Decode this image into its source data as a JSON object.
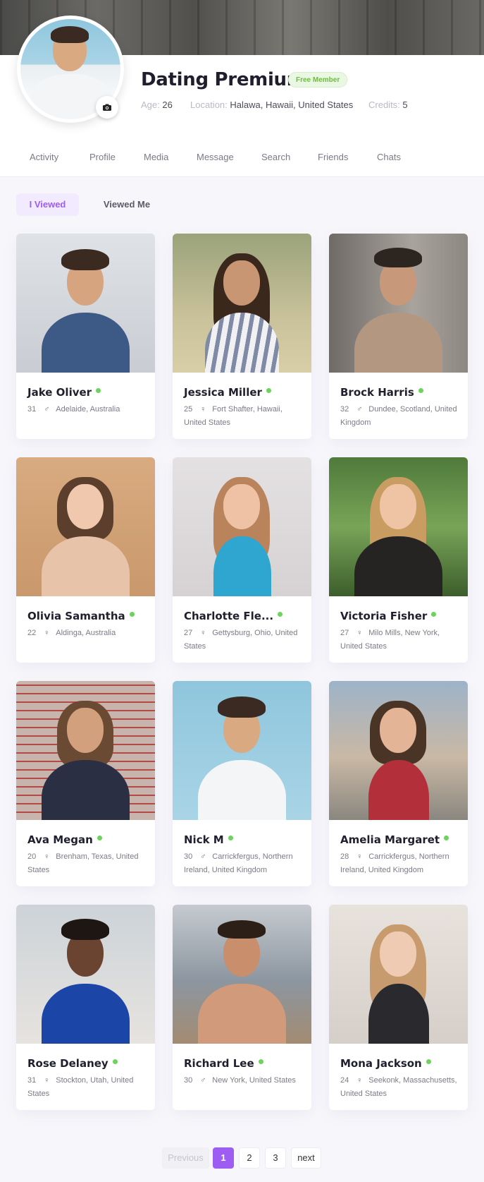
{
  "profile": {
    "name": "Dating Premium",
    "badge": "Free Member",
    "age_label": "Age:",
    "age": "26",
    "location_label": "Location:",
    "location": "Halawa, Hawaii, United States",
    "credits_label": "Credits:",
    "credits": "5"
  },
  "tabs": [
    "Activity",
    "Profile",
    "Media",
    "Message",
    "Search",
    "Friends",
    "Chats"
  ],
  "subtabs": {
    "active": "I Viewed",
    "other": "Viewed Me"
  },
  "members": [
    {
      "name": "Jake Oliver",
      "age": "31",
      "gender": "♂",
      "location": "Adelaide, Australia"
    },
    {
      "name": "Jessica Miller",
      "age": "25",
      "gender": "♀",
      "location": "Fort Shafter, Hawaii, United States"
    },
    {
      "name": "Brock Harris",
      "age": "32",
      "gender": "♂",
      "location": "Dundee, Scotland, United Kingdom"
    },
    {
      "name": "Olivia Samantha",
      "age": "22",
      "gender": "♀",
      "location": "Aldinga, Australia"
    },
    {
      "name": "Charlotte Fle...",
      "age": "27",
      "gender": "♀",
      "location": "Gettysburg, Ohio, United States"
    },
    {
      "name": "Victoria Fisher",
      "age": "27",
      "gender": "♀",
      "location": "Milo Mills, New York, United States"
    },
    {
      "name": "Ava Megan",
      "age": "20",
      "gender": "♀",
      "location": "Brenham, Texas, United States"
    },
    {
      "name": "Nick M",
      "age": "30",
      "gender": "♂",
      "location": "Carrickfergus, Northern Ireland, United Kingdom"
    },
    {
      "name": "Amelia Margaret",
      "age": "28",
      "gender": "♀",
      "location": "Carrickfergus, Northern Ireland, United Kingdom"
    },
    {
      "name": "Rose Delaney",
      "age": "31",
      "gender": "♀",
      "location": "Stockton, Utah, United States"
    },
    {
      "name": "Richard Lee",
      "age": "30",
      "gender": "♂",
      "location": "New York, United States"
    },
    {
      "name": "Mona Jackson",
      "age": "24",
      "gender": "♀",
      "location": "Seekonk, Massachusetts, United States"
    }
  ],
  "pagination": {
    "previous": "Previous",
    "pages": [
      "1",
      "2",
      "3"
    ],
    "next": "next",
    "current": "1"
  },
  "colors": {
    "accent": "#9d5cf2",
    "online": "#6dd35d",
    "badge_text": "#6abf3b",
    "badge_bg": "#eaf7e2"
  },
  "icons": {
    "camera": "camera-icon",
    "male": "male-icon",
    "female": "female-icon",
    "online": "online-dot"
  }
}
